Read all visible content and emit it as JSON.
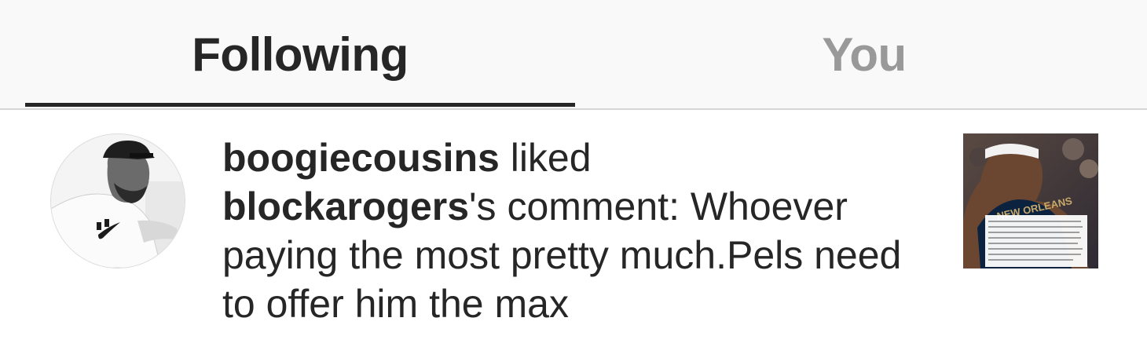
{
  "tabs": {
    "following_label": "Following",
    "you_label": "You",
    "active": "Following"
  },
  "notification": {
    "actor": "boogiecousins",
    "verb": " liked",
    "target_user": "blockarogers",
    "comment_prefix": "'s comment: ",
    "comment_text": "Whoever paying the most pretty much.Pels need to offer him the max"
  },
  "thumbnail": {
    "jersey_text": "NEW ORLEANS"
  },
  "colors": {
    "active_tab": "#262626",
    "inactive_tab": "#999999",
    "tabbar_bg": "#f9f9f9",
    "jersey_navy": "#0c2340"
  }
}
